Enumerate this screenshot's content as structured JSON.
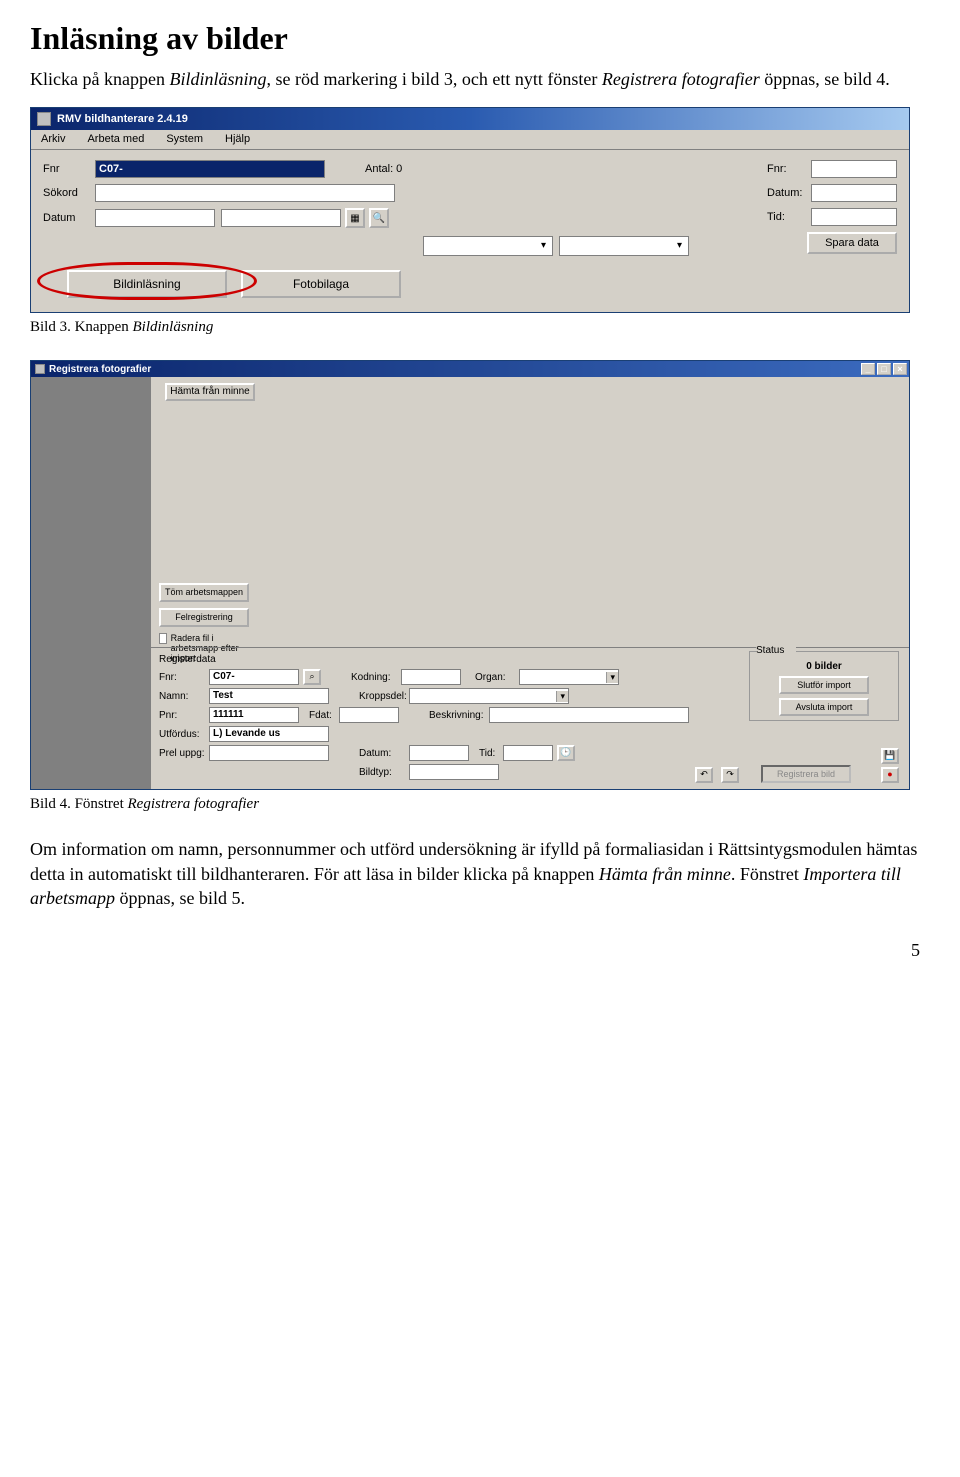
{
  "heading": "Inläsning av bilder",
  "intro_plain1": "Klicka på knappen ",
  "intro_em1": "Bildinläsning",
  "intro_plain2": ", se röd markering i bild 3, och ett nytt fönster ",
  "intro_em2": "Registrera fotografier",
  "intro_plain3": " öppnas, se bild 4.",
  "caption1_plain": "Bild 3. Knappen ",
  "caption1_em": "Bildinläsning",
  "caption2_plain": "Bild 4. Fönstret ",
  "caption2_em": "Registrera fotografier",
  "para2_a": "Om information om namn, personnummer och utförd undersökning är ifylld på formaliasidan i Rättsintygsmodulen hämtas detta in automatiskt till bildhanteraren. För att läsa in bilder klicka på knappen ",
  "para2_em1": "Hämta från minne",
  "para2_b": ". Fönstret ",
  "para2_em2": "Importera till arbetsmapp",
  "para2_c": " öppnas, se bild 5.",
  "page_number": "5",
  "app1": {
    "title": "RMV bildhanterare 2.4.19",
    "menu": [
      "Arkiv",
      "Arbeta med",
      "System",
      "Hjälp"
    ],
    "labels": {
      "fnr": "Fnr",
      "sokord": "Sökord",
      "datum": "Datum",
      "antal": "Antal: 0",
      "fnr2": "Fnr:",
      "datum2": "Datum:",
      "tid": "Tid:"
    },
    "fnr_value": "C07-",
    "spara": "Spara data",
    "tab1": "Bildinläsning",
    "tab2": "Fotobilaga"
  },
  "app2": {
    "title": "Registrera fotografier",
    "hamta": "Hämta från minne",
    "tom": "Töm arbetsmappen",
    "felreg": "Felregistrering",
    "radera_chk": "Radera fil i arbetsmapp efter import",
    "regdata": "Registerdata",
    "lbl": {
      "fnr": "Fnr:",
      "namn": "Namn:",
      "pnr": "Pnr:",
      "fdat": "Fdat:",
      "utford": "Utfördus:",
      "preluppg": "Prel uppg:",
      "kodning": "Kodning:",
      "organ": "Organ:",
      "kroppsdel": "Kroppsdel:",
      "beskriv": "Beskrivning:",
      "datum": "Datum:",
      "tid": "Tid:",
      "bildtyp": "Bildtyp:"
    },
    "vals": {
      "fnr": "C07-",
      "namn": "Test",
      "pnr": "111111",
      "utford": "L) Levande us"
    },
    "status_label": "Status",
    "status_count": "0 bilder",
    "slutfor": "Slutför import",
    "avsluta": "Avsluta import",
    "registrera": "Registrera bild"
  }
}
